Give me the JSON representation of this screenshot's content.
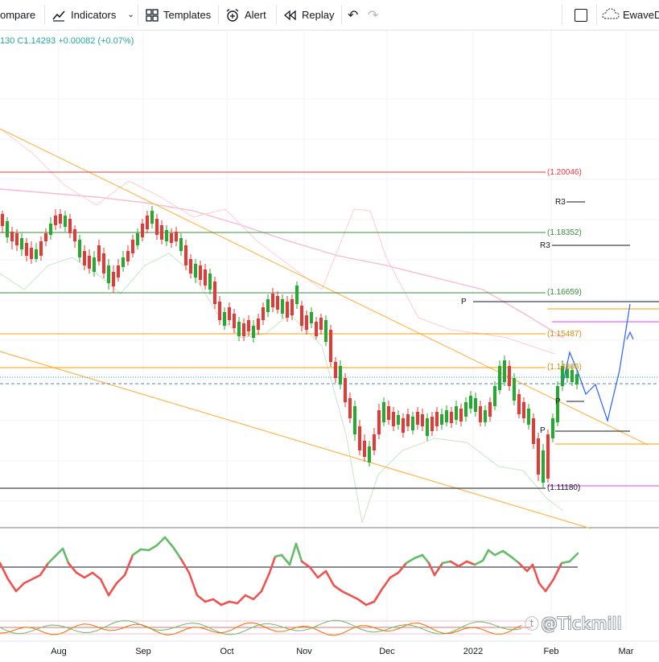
{
  "toolbar": {
    "compare_label": "ompare",
    "indicators_label": "Indicators",
    "templates_label": "Templates",
    "alert_label": "Alert",
    "replay_label": "Replay",
    "layout_label": "EwaveD"
  },
  "legend": {
    "ohlc_text": "130  C1.14293  +0.00082 (+0.07%)"
  },
  "price_levels": [
    {
      "label": "(1.20046)",
      "color": "#f23645"
    },
    {
      "label": "(1.18352)",
      "color": "#388e3c"
    },
    {
      "label": "(1.16659)",
      "color": "#388e3c"
    },
    {
      "label": "(1.15487)",
      "color": "#ff9800"
    },
    {
      "label": "(1.14306)",
      "color": "#ff9800"
    },
    {
      "label": "(1.11180)",
      "color": "#131722"
    }
  ],
  "pivot_labels": {
    "r3_upper": "R3",
    "r3_lower": "R3",
    "p_upper": "P",
    "p_mid": "P",
    "p_lower": "P"
  },
  "time_axis": {
    "months": [
      "Aug",
      "Sep",
      "Oct",
      "Nov",
      "Dec",
      "2022",
      "Feb",
      "Mar"
    ]
  },
  "watermark": "@Tickmill",
  "colors": {
    "up": "#26a69a",
    "up_candle": "#22ab2e",
    "down": "#e53935",
    "trendline": "#ffb74d",
    "projection": "#2962ff",
    "rsi_up": "#66bb6a",
    "rsi_down": "#ef5350"
  }
}
